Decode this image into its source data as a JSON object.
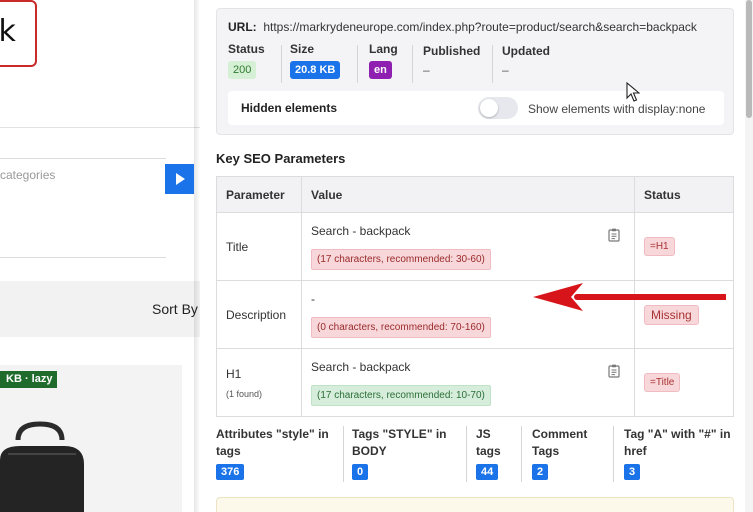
{
  "site": {
    "logo_text": "ck",
    "search_placeholder": "categories",
    "sort_label": "Sort By",
    "image_badge": "KB · lazy"
  },
  "panel": {
    "url_label": "URL:",
    "url_value": "https://markrydeneurope.com/index.php?route=product/search&search=backpack",
    "meta": {
      "status_label": "Status",
      "status_value": "200",
      "size_label": "Size",
      "size_value": "20.8 KB",
      "lang_label": "Lang",
      "lang_value": "en",
      "published_label": "Published",
      "published_value": "–",
      "updated_label": "Updated",
      "updated_value": "–"
    },
    "hidden_elements": {
      "label": "Hidden elements",
      "toggle_text": "Show elements with display:none",
      "enabled": false
    },
    "seo_heading": "Key SEO Parameters",
    "table": {
      "headers": [
        "Parameter",
        "Value",
        "Status"
      ],
      "rows": [
        {
          "param": "Title",
          "sub": "",
          "value": "Search - backpack",
          "hint": "(17 characters, recommended: 30-60)",
          "hint_type": "red",
          "status": "=H1"
        },
        {
          "param": "Description",
          "sub": "",
          "value": "-",
          "hint": "(0 characters, recommended: 70-160)",
          "hint_type": "red",
          "status": "Missing"
        },
        {
          "param": "H1",
          "sub": "(1 found)",
          "value": "Search - backpack",
          "hint": "(17 characters, recommended: 10-70)",
          "hint_type": "green",
          "status": "=Title"
        }
      ]
    },
    "counters": [
      {
        "label": "Attributes \"style\" in tags",
        "value": "376"
      },
      {
        "label": "Tags \"STYLE\" in BODY",
        "value": "0"
      },
      {
        "label": "JS tags",
        "value": "44"
      },
      {
        "label": "Comment Tags",
        "value": "2"
      },
      {
        "label": "Tag \"A\" with \"#\" in href",
        "value": "3"
      }
    ]
  },
  "colors": {
    "accent_blue": "#1a73e8",
    "lang_purple": "#8f1fb0",
    "annotation_red": "#d7141a",
    "logo_red": "#c92a2a"
  },
  "icons": [
    "play-icon",
    "clipboard-icon",
    "annotation-arrow",
    "mouse-cursor-icon",
    "backpack-image"
  ]
}
